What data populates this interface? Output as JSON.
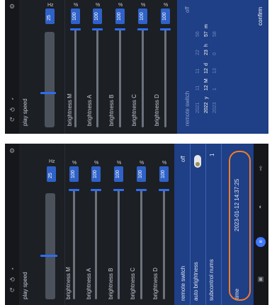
{
  "top": {
    "play_speed_label": "play speed",
    "speed_value": "25",
    "speed_unit": "Hz",
    "sliders": [
      {
        "label": "brightness M",
        "value": "100",
        "unit": "%"
      },
      {
        "label": "brightness A",
        "value": "100",
        "unit": "%"
      },
      {
        "label": "brightness B",
        "value": "100",
        "unit": "%"
      },
      {
        "label": "brightness C",
        "value": "100",
        "unit": "%"
      },
      {
        "label": "brightness D",
        "value": "100",
        "unit": "%"
      }
    ],
    "remote_switch_label": "remote switch",
    "picker": {
      "years": [
        "2021",
        "2022",
        "2023"
      ],
      "year_unit": "y",
      "months": [
        "11",
        "12",
        "1"
      ],
      "month_unit": "M",
      "days": [
        "11",
        "12",
        "13"
      ],
      "day_unit": "d",
      "hours": [
        "22",
        "23",
        "0"
      ],
      "hour_unit": "h",
      "minutes": [
        "56",
        "57",
        "58"
      ],
      "minute_unit": "m",
      "confirm_label": "confirm"
    }
  },
  "bottom": {
    "play_speed_label": "play speed",
    "speed_value": "25",
    "speed_unit": "Hz",
    "sliders": [
      {
        "label": "brightness M",
        "value": "100",
        "unit": "%"
      },
      {
        "label": "brightness A",
        "value": "100",
        "unit": "%"
      },
      {
        "label": "brightness B",
        "value": "100",
        "unit": "%"
      },
      {
        "label": "brightness C",
        "value": "100",
        "unit": "%"
      },
      {
        "label": "brightness D",
        "value": "100",
        "unit": "%"
      }
    ],
    "settings": {
      "remote_switch_label": "remote switch",
      "remote_switch_value": "off",
      "auto_brightness_label": "auto brightness",
      "subcontrol_label": "subcontrol nums",
      "subcontrol_value": "1",
      "time_label": "time",
      "time_value": "2023-01-12 14:37:25"
    }
  },
  "colors": {
    "accent": "#2f62c9",
    "panel": "#1f3f86",
    "highlight": "#f07d2a"
  }
}
